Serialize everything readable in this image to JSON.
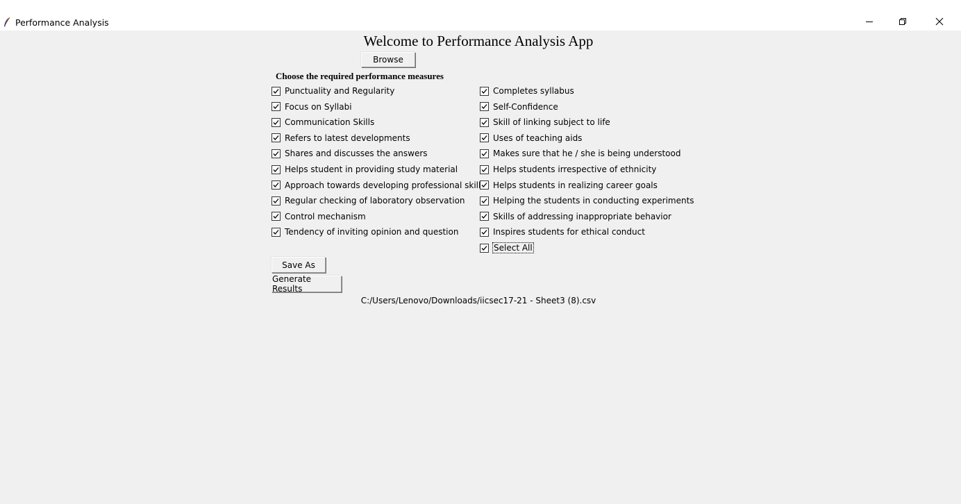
{
  "window": {
    "title": "Performance Analysis",
    "minimize_icon": "minimize-icon",
    "restore_icon": "restore-icon",
    "close_icon": "close-icon"
  },
  "main": {
    "welcome": "Welcome to Performance Analysis App",
    "browse_label": "Browse",
    "choose_label": "Choose the required performance measures",
    "left_measures": [
      {
        "label": "Punctuality and Regularity",
        "checked": true
      },
      {
        "label": "Focus on Syllabi",
        "checked": true
      },
      {
        "label": "Communication Skills",
        "checked": true
      },
      {
        "label": "Refers to latest developments",
        "checked": true
      },
      {
        "label": "Shares and discusses the answers",
        "checked": true
      },
      {
        "label": "Helps student in providing study material",
        "checked": true
      },
      {
        "label": "Approach towards developing professional skills",
        "checked": true
      },
      {
        "label": "Regular checking of laboratory observation",
        "checked": true
      },
      {
        "label": "Control mechanism",
        "checked": true
      },
      {
        "label": "Tendency of inviting opinion and question",
        "checked": true
      }
    ],
    "right_measures": [
      {
        "label": "Completes syllabus",
        "checked": true
      },
      {
        "label": "Self-Confidence",
        "checked": true
      },
      {
        "label": "Skill of linking subject to life",
        "checked": true
      },
      {
        "label": "Uses of teaching aids",
        "checked": true
      },
      {
        "label": "Makes sure that he / she is being understood",
        "checked": true
      },
      {
        "label": "Helps students irrespective of ethnicity",
        "checked": true
      },
      {
        "label": "Helps students in realizing career goals",
        "checked": true
      },
      {
        "label": "Helping the students in conducting experiments",
        "checked": true
      },
      {
        "label": "Skills of addressing inappropriate behavior",
        "checked": true
      },
      {
        "label": "Inspires students for ethical conduct",
        "checked": true
      }
    ],
    "select_all": {
      "label": "Select All",
      "checked": true
    },
    "save_as_label": "Save As",
    "generate_label": "Generate Results",
    "file_path": "C:/Users/Lenovo/Downloads/iicsec17-21 - Sheet3 (8).csv"
  }
}
